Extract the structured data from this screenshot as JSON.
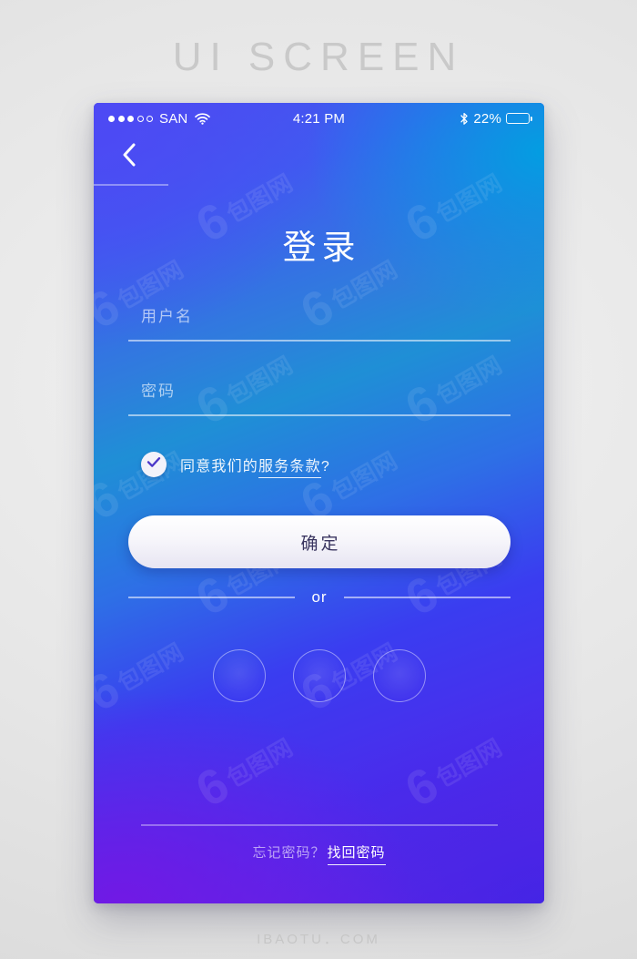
{
  "page": {
    "heading": "UI SCREEN",
    "footer": "IBAOTU．COM",
    "watermark": "包图网"
  },
  "colors": {
    "gradient_top_left": "#4a4ef0",
    "gradient_top_right": "#1f8fd6",
    "gradient_bottom_left": "#6a20e2",
    "gradient_bottom_right": "#3a26e6",
    "button_text": "#3a3560",
    "accent_white": "#ffffff"
  },
  "status_bar": {
    "carrier": "SAN",
    "signal_dots_filled": 3,
    "signal_dots_total": 5,
    "wifi_icon": "wifi-icon",
    "time": "4:21 PM",
    "bluetooth_icon": "bluetooth-icon",
    "battery_percent": "22%",
    "battery_level": 22
  },
  "nav": {
    "back_icon": "chevron-left-icon"
  },
  "screen": {
    "title": "登录"
  },
  "form": {
    "username": {
      "placeholder": "用户名",
      "value": ""
    },
    "password": {
      "placeholder": "密码",
      "value": ""
    },
    "terms": {
      "checked": true,
      "check_icon": "check-icon",
      "prefix": "同意我们的",
      "link": "服务条款",
      "suffix": "?"
    },
    "submit_label": "确定"
  },
  "divider": {
    "label": "or"
  },
  "social": {
    "buttons": [
      {
        "name": "social-login-1"
      },
      {
        "name": "social-login-2"
      },
      {
        "name": "social-login-3"
      }
    ]
  },
  "footer_links": {
    "question": "忘记密码？",
    "link": "找回密码"
  }
}
